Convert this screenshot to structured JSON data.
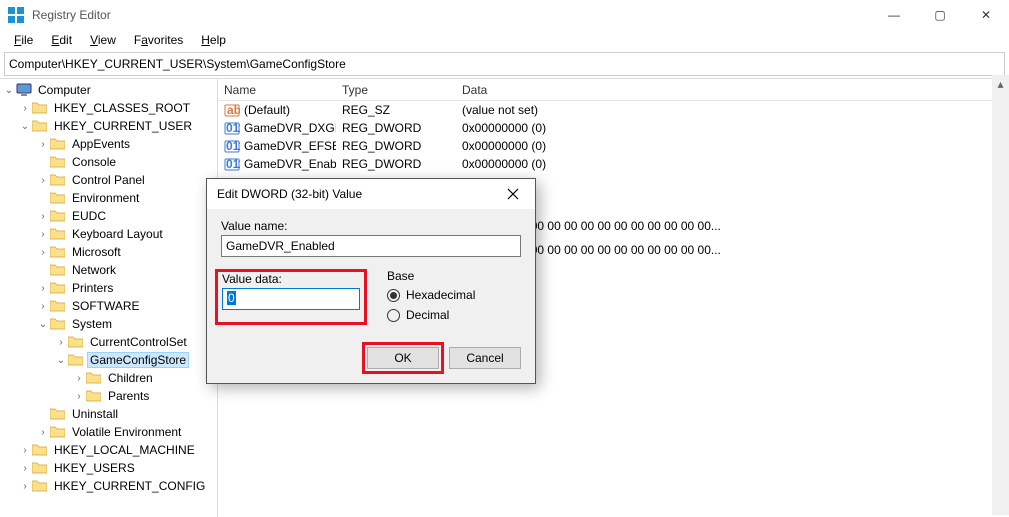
{
  "window": {
    "title": "Registry Editor",
    "controls": {
      "min": "—",
      "max": "▢",
      "close": "✕"
    }
  },
  "menu": {
    "file": "File",
    "edit": "Edit",
    "view": "View",
    "favorites": "Favorites",
    "help": "Help"
  },
  "address": "Computer\\HKEY_CURRENT_USER\\System\\GameConfigStore",
  "tree": {
    "root": "Computer",
    "hkcr": "HKEY_CLASSES_ROOT",
    "hkcu": "HKEY_CURRENT_USER",
    "hkcu_children": {
      "appEvents": "AppEvents",
      "console": "Console",
      "controlPanel": "Control Panel",
      "environment": "Environment",
      "eudc": "EUDC",
      "keyboard": "Keyboard Layout",
      "microsoft": "Microsoft",
      "network": "Network",
      "printers": "Printers",
      "software": "SOFTWARE",
      "system": "System",
      "system_children": {
        "ccs": "CurrentControlSet",
        "gcs": "GameConfigStore",
        "gcs_children": {
          "children": "Children",
          "parents": "Parents"
        }
      },
      "uninstall": "Uninstall",
      "volatile": "Volatile Environment"
    },
    "hklm": "HKEY_LOCAL_MACHINE",
    "hku": "HKEY_USERS",
    "hkcc": "HKEY_CURRENT_CONFIG"
  },
  "list": {
    "headers": {
      "name": "Name",
      "type": "Type",
      "data": "Data"
    },
    "rows": [
      {
        "icon": "sz",
        "name": "(Default)",
        "type": "REG_SZ",
        "data": "(value not set)"
      },
      {
        "icon": "dw",
        "name": "GameDVR_DXGI...",
        "type": "REG_DWORD",
        "data": "0x00000000 (0)"
      },
      {
        "icon": "dw",
        "name": "GameDVR_EFSE...",
        "type": "REG_DWORD",
        "data": "0x00000000 (0)"
      },
      {
        "icon": "dw",
        "name": "GameDVR_Enabl...",
        "type": "REG_DWORD",
        "data": "0x00000000 (0)"
      }
    ],
    "extra": [
      "00 00 00 00 00 00 00 00 00 00 00 00 00 00 00...",
      "00 00 00 00 00 00 00 00 00 00 00 00 00 00 00..."
    ]
  },
  "dialog": {
    "title": "Edit DWORD (32-bit) Value",
    "valueNameLabel": "Value name:",
    "valueName": "GameDVR_Enabled",
    "valueDataLabel": "Value data:",
    "valueData": "0",
    "baseLabel": "Base",
    "hex": "Hexadecimal",
    "dec": "Decimal",
    "ok": "OK",
    "cancel": "Cancel"
  }
}
